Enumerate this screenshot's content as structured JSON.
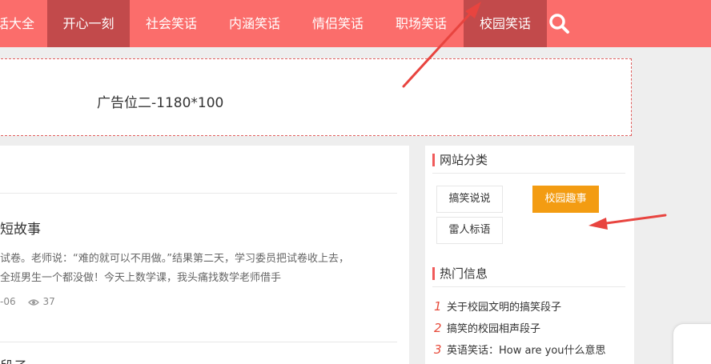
{
  "nav": {
    "items": [
      {
        "label": "话大全"
      },
      {
        "label": "开心一刻"
      },
      {
        "label": "社会笑话"
      },
      {
        "label": "内涵笑话"
      },
      {
        "label": "情侣笑话"
      },
      {
        "label": "职场笑话"
      },
      {
        "label": "校园笑话"
      }
    ],
    "search_icon": "search-icon",
    "colors": {
      "bar": "#fb6d6b",
      "active": "#c24a4b"
    }
  },
  "ad": {
    "text": "广告位二-1180*100"
  },
  "main": {
    "article1": {
      "title": "短故事",
      "excerpt_line1": "试卷。老师说：“难的就可以不用做。”结果第二天，学习委员把试卷收上去，",
      "excerpt_line2": "全班男生一个都没做！今天上数学课，我头痛找数学老师借手",
      "date": "-06",
      "views": "37"
    },
    "article2": {
      "title": "段子"
    }
  },
  "sidebar": {
    "categories": {
      "title": "网站分类",
      "tags": [
        {
          "label": "搞笑说说"
        },
        {
          "label": "校园趣事"
        },
        {
          "label": "雷人标语"
        }
      ],
      "active_color": "#f39c12"
    },
    "hot": {
      "title": "热门信息",
      "items": [
        {
          "num": "1",
          "label": "关于校园文明的搞笑段子"
        },
        {
          "num": "2",
          "label": "搞笑的校园相声段子"
        },
        {
          "num": "3",
          "label": "英语笑话：How are you什么意思"
        }
      ]
    }
  },
  "annotation_color": "#e8443f"
}
